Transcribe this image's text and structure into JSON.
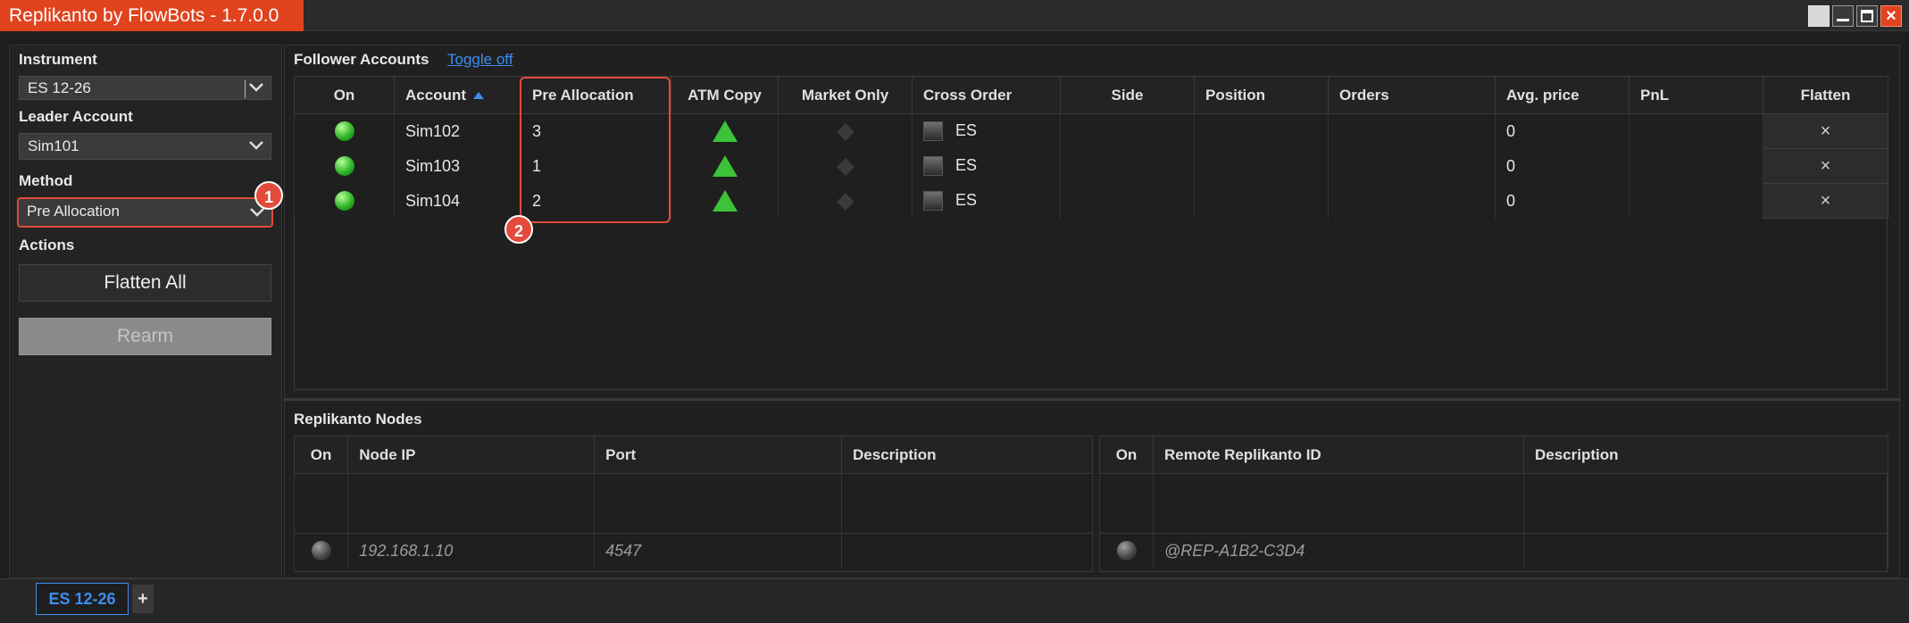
{
  "window": {
    "title": "Replikanto by FlowBots - 1.7.0.0"
  },
  "left": {
    "instrument_label": "Instrument",
    "instrument_value": "ES 12-26",
    "leader_label": "Leader Account",
    "leader_value": "Sim101",
    "method_label": "Method",
    "method_value": "Pre Allocation",
    "actions_label": "Actions",
    "flatten_all": "Flatten All",
    "rearm": "Rearm"
  },
  "badges": {
    "one": "1",
    "two": "2"
  },
  "followers": {
    "title": "Follower Accounts",
    "toggle_link": "Toggle off",
    "columns": [
      "On",
      "Account",
      "Pre Allocation",
      "ATM Copy",
      "Market Only",
      "Cross Order",
      "Side",
      "Position",
      "Orders",
      "Avg. price",
      "PnL",
      "Flatten"
    ],
    "sort_column": "Account",
    "rows": [
      {
        "on": true,
        "account": "Sim102",
        "pre_allocation": "3",
        "atm_copy": true,
        "market_only": false,
        "cross_order": "ES",
        "side": "",
        "position": "",
        "orders": "",
        "avg_price": "0",
        "pnl": "",
        "flatten": "×"
      },
      {
        "on": true,
        "account": "Sim103",
        "pre_allocation": "1",
        "atm_copy": true,
        "market_only": false,
        "cross_order": "ES",
        "side": "",
        "position": "",
        "orders": "",
        "avg_price": "0",
        "pnl": "",
        "flatten": "×"
      },
      {
        "on": true,
        "account": "Sim104",
        "pre_allocation": "2",
        "atm_copy": true,
        "market_only": false,
        "cross_order": "ES",
        "side": "",
        "position": "",
        "orders": "",
        "avg_price": "0",
        "pnl": "",
        "flatten": "×"
      }
    ]
  },
  "nodes": {
    "title": "Replikanto Nodes",
    "left_columns": [
      "On",
      "Node IP",
      "Port",
      "Description"
    ],
    "left_new_row": {
      "ip": "192.168.1.10",
      "port": "4547",
      "description": ""
    },
    "right_columns": [
      "On",
      "Remote Replikanto ID",
      "Description"
    ],
    "right_new_row": {
      "remote_id": "@REP-A1B2-C3D4",
      "description": ""
    }
  },
  "tabs": {
    "active": "ES 12-26",
    "add": "+"
  },
  "colors": {
    "accent": "#e0431e",
    "link": "#3d8ef0",
    "highlight": "#e24a3b",
    "on": "#2fb52a"
  }
}
